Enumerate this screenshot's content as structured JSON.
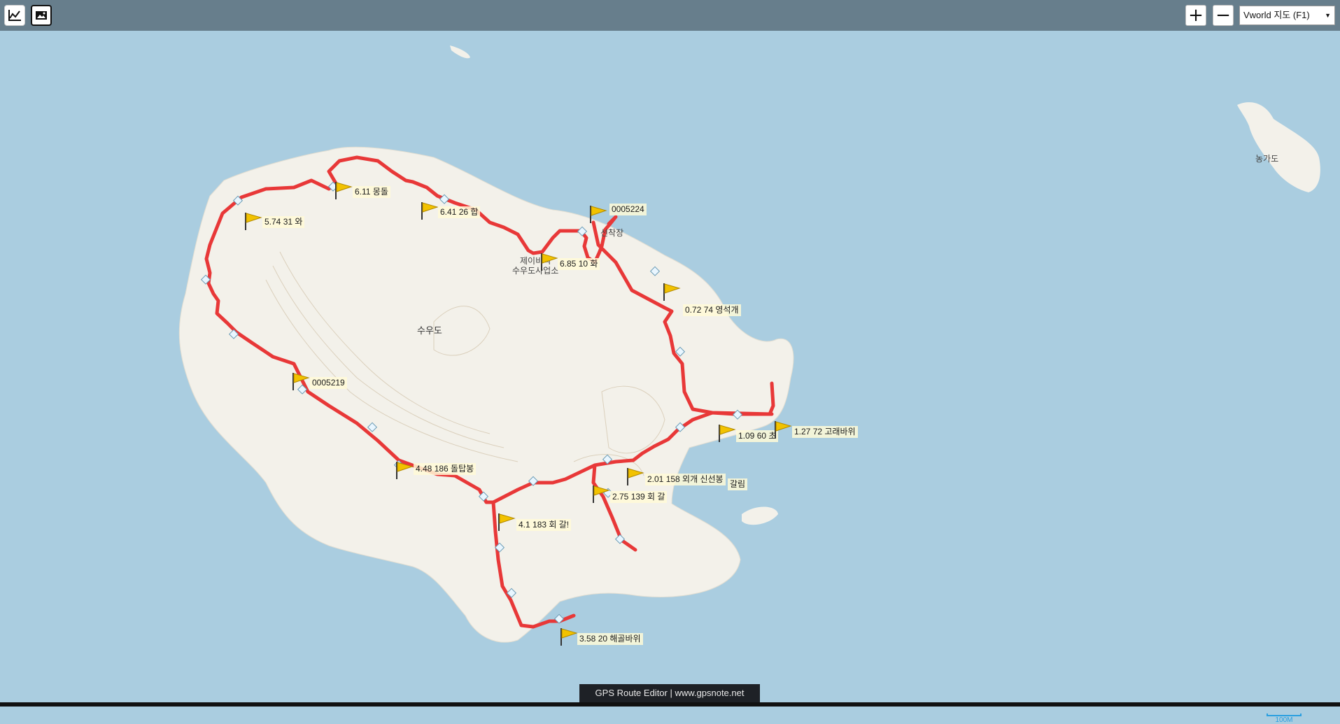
{
  "toolbar": {
    "chart_icon": "line-chart-icon",
    "image_icon": "image-icon",
    "zoom_in_label": "+",
    "zoom_out_label": "−",
    "layer_select_value": "Vworld 지도 (F1)"
  },
  "map": {
    "place_labels": {
      "island": "수우도",
      "island_east": "농가도",
      "facility_line1": "제이비씨",
      "facility_line2": "수우도사업소",
      "pier": "선착장"
    },
    "waypoints": [
      {
        "label": "0005224"
      },
      {
        "label": "0.72 74 영석개"
      },
      {
        "label": "1.09 60 초"
      },
      {
        "label": "1.27 72 고래바위"
      },
      {
        "label": "2.01 158 외개 신선봉"
      },
      {
        "label": "갈림"
      },
      {
        "label": "2.75 139 회 갈"
      },
      {
        "label": "4.1 183 회 갈!"
      },
      {
        "label": "4.48 186 돌탑봉"
      },
      {
        "label": "3.58 20 해골바위"
      },
      {
        "label": "0005219"
      },
      {
        "label": "5.74 31 와"
      },
      {
        "label": "6.11 몽돌"
      },
      {
        "label": "6.41 26 합"
      },
      {
        "label": "6.85 10 화"
      }
    ],
    "route_color": "#e83838",
    "flag_color": "#f2c200",
    "scale_label": "100M"
  },
  "footer": {
    "text": "GPS Route Editor | www.gpsnote.net"
  }
}
